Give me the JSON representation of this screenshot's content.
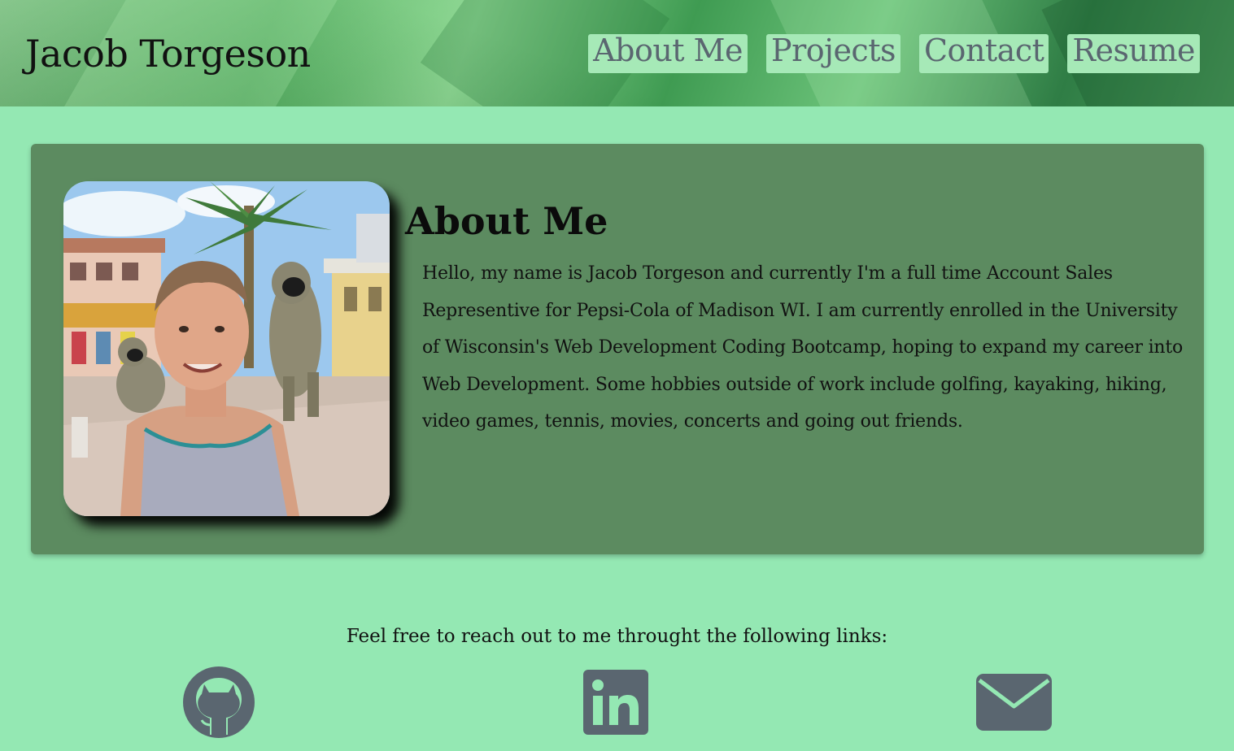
{
  "header": {
    "brand": "Jacob Torgeson",
    "nav": [
      "About Me",
      "Projects",
      "Contact",
      "Resume"
    ]
  },
  "about": {
    "title": "About Me",
    "body": "Hello, my name is Jacob Torgeson and currently I'm a full time Account Sales Representive for Pepsi-Cola of Madison WI. I am currently enrolled in the University of Wisconsin's Web Development Coding Bootcamp, hoping to expand my career into Web Development. Some hobbies outside of work include golfing, kayaking, hiking, video games, tennis, movies, concerts and going out friends."
  },
  "footer": {
    "reach_text": "Feel free to reach out to me throught the following links:",
    "icons": [
      "github-icon",
      "linkedin-icon",
      "envelope-icon"
    ]
  },
  "colors": {
    "page_bg": "#94e8b3",
    "card_bg": "#5c8b60",
    "nav_bg": "#a6e9b7",
    "nav_text": "#5a6670",
    "icon": "#5a6670"
  }
}
